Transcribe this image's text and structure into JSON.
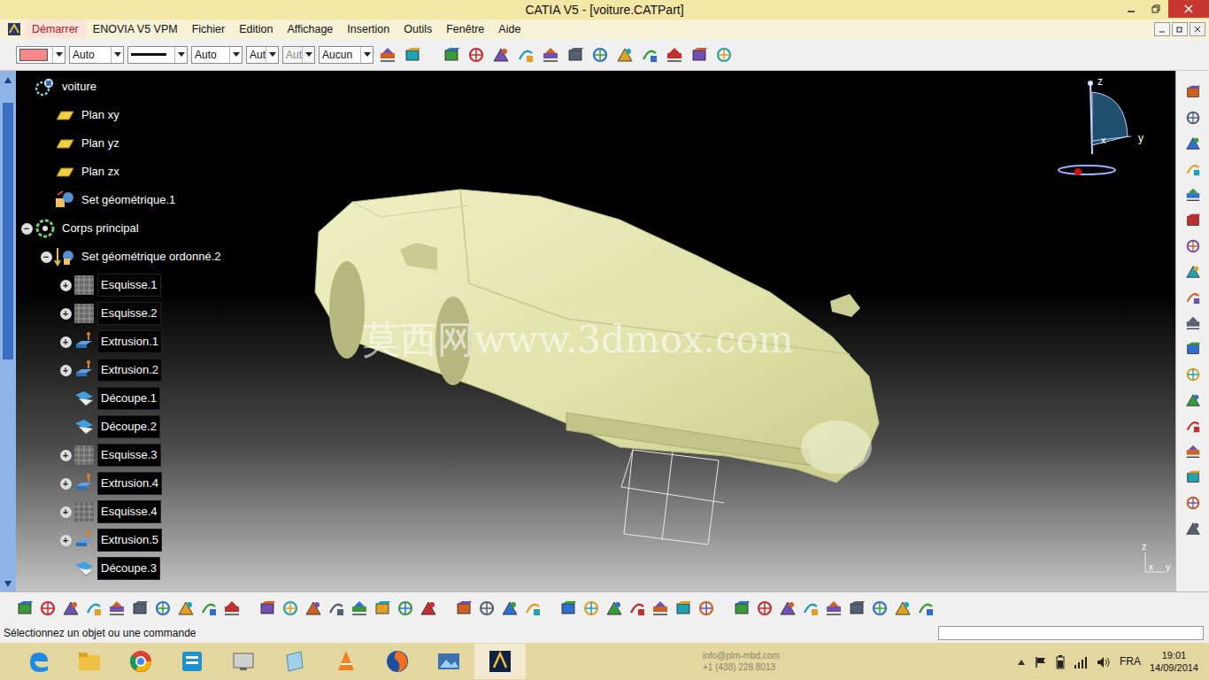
{
  "window": {
    "title": "CATIA V5 - [voiture.CATPart]"
  },
  "menu": [
    {
      "label": "Démarrer",
      "selected": true
    },
    {
      "label": "ENOVIA V5 VPM",
      "selected": false
    },
    {
      "label": "Fichier",
      "selected": false
    },
    {
      "label": "Edition",
      "selected": false
    },
    {
      "label": "Affichage",
      "selected": false
    },
    {
      "label": "Insertion",
      "selected": false
    },
    {
      "label": "Outils",
      "selected": false
    },
    {
      "label": "Fenêtre",
      "selected": false
    },
    {
      "label": "Aide",
      "selected": false
    }
  ],
  "properties": {
    "color": "#f4878a",
    "fields": [
      {
        "kind": "text",
        "value": "Auto",
        "disabled": false
      },
      {
        "kind": "line",
        "disabled": false
      },
      {
        "kind": "text",
        "value": "Auto",
        "disabled": false
      },
      {
        "kind": "text",
        "value": "Aut",
        "disabled": false
      },
      {
        "kind": "text",
        "value": "Aut",
        "disabled": true
      },
      {
        "kind": "text",
        "value": "Aucun",
        "disabled": false
      }
    ]
  },
  "tree": [
    {
      "label": "voiture",
      "depth": 0,
      "kind": "part",
      "highlighted": false
    },
    {
      "label": "Plan xy",
      "depth": 1,
      "kind": "plane",
      "highlighted": false
    },
    {
      "label": "Plan yz",
      "depth": 1,
      "kind": "plane",
      "highlighted": false
    },
    {
      "label": "Plan zx",
      "depth": 1,
      "kind": "plane",
      "highlighted": false
    },
    {
      "label": "Set géométrique.1",
      "depth": 1,
      "kind": "geoset",
      "highlighted": false
    },
    {
      "label": "Corps principal",
      "depth": 0,
      "kind": "body",
      "toggle": "−",
      "highlighted": false
    },
    {
      "label": "Set géométrique ordonné.2",
      "depth": 1,
      "kind": "ordered",
      "toggle": "−",
      "highlighted": false
    },
    {
      "label": "Esquisse.1",
      "depth": 2,
      "kind": "sketch",
      "toggle": "+",
      "highlighted": true
    },
    {
      "label": "Esquisse.2",
      "depth": 2,
      "kind": "sketch",
      "toggle": "+",
      "highlighted": true
    },
    {
      "label": "Extrusion.1",
      "depth": 2,
      "kind": "extrude",
      "toggle": "+",
      "highlighted": true
    },
    {
      "label": "Extrusion.2",
      "depth": 2,
      "kind": "extrude",
      "toggle": "+",
      "highlighted": true
    },
    {
      "label": "Découpe.1",
      "depth": 2,
      "kind": "split",
      "highlighted": true
    },
    {
      "label": "Découpe.2",
      "depth": 2,
      "kind": "split",
      "highlighted": true
    },
    {
      "label": "Esquisse.3",
      "depth": 2,
      "kind": "sketch",
      "toggle": "+",
      "highlighted": true
    },
    {
      "label": "Extrusion.4",
      "depth": 2,
      "kind": "extrude",
      "toggle": "+",
      "highlighted": true
    },
    {
      "label": "Esquisse.4",
      "depth": 2,
      "kind": "sketch",
      "toggle": "+",
      "highlighted": true
    },
    {
      "label": "Extrusion.5",
      "depth": 2,
      "kind": "extrude",
      "toggle": "+",
      "highlighted": true
    },
    {
      "label": "Découpe.3",
      "depth": 2,
      "kind": "split",
      "highlighted": true
    }
  ],
  "viewport": {
    "watermark": "莫西网www.3dmox.com",
    "compass": [
      "z",
      "y",
      "x"
    ],
    "axis": [
      "z",
      "x",
      "y"
    ]
  },
  "status_bar": {
    "message": "Sélectionnez un objet ou une commande"
  },
  "taskbar": {
    "contact": [
      "info@plm-mbd.com",
      "+1 (438) 228 8013"
    ],
    "language": "FRA",
    "time": "19:01",
    "date": "14/09/2014"
  }
}
